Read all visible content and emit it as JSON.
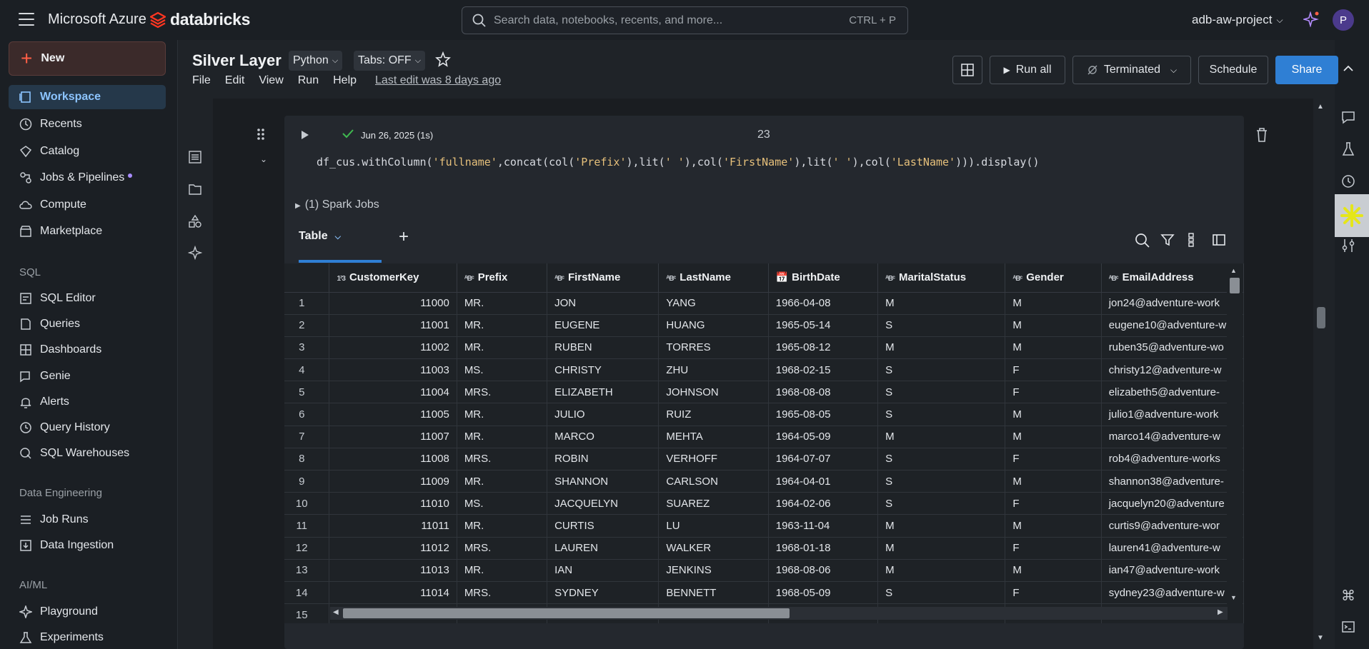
{
  "topbar": {
    "brand": "Microsoft Azure",
    "product": "databricks",
    "search_placeholder": "Search data, notebooks, recents, and more...",
    "search_shortcut": "CTRL + P",
    "workspace": "adb-aw-project",
    "avatar_initial": "P"
  },
  "sidebar": {
    "new_label": "New",
    "items": [
      {
        "label": "Workspace",
        "icon": "workspace-icon",
        "active": true
      },
      {
        "label": "Recents",
        "icon": "clock-icon"
      },
      {
        "label": "Catalog",
        "icon": "catalog-icon"
      },
      {
        "label": "Jobs & Pipelines",
        "icon": "jobs-icon"
      },
      {
        "label": "Compute",
        "icon": "cloud-icon"
      },
      {
        "label": "Marketplace",
        "icon": "store-icon"
      }
    ],
    "sql_section": "SQL",
    "sql_items": [
      {
        "label": "SQL Editor",
        "icon": "sql-editor-icon"
      },
      {
        "label": "Queries",
        "icon": "queries-icon"
      },
      {
        "label": "Dashboards",
        "icon": "dashboard-icon"
      },
      {
        "label": "Genie",
        "icon": "genie-icon"
      },
      {
        "label": "Alerts",
        "icon": "bell-icon"
      },
      {
        "label": "Query History",
        "icon": "history-icon"
      },
      {
        "label": "SQL Warehouses",
        "icon": "warehouse-icon"
      }
    ],
    "de_section": "Data Engineering",
    "de_items": [
      {
        "label": "Job Runs",
        "icon": "list-icon"
      },
      {
        "label": "Data Ingestion",
        "icon": "ingestion-icon"
      }
    ],
    "ai_section": "AI/ML",
    "ai_items": [
      {
        "label": "Playground",
        "icon": "sparkle-icon"
      },
      {
        "label": "Experiments",
        "icon": "flask-icon"
      }
    ]
  },
  "notebook": {
    "title": "Silver Layer",
    "language": "Python",
    "tabs": "Tabs: OFF",
    "menu": [
      "File",
      "Edit",
      "View",
      "Run",
      "Help"
    ],
    "last_edit": "Last edit was 8 days ago",
    "run_all": "Run all",
    "cluster": "Terminated",
    "schedule": "Schedule",
    "share": "Share"
  },
  "cell": {
    "exec_time": "Jun 26, 2025 (1s)",
    "number": "23",
    "spark_jobs": "(1) Spark Jobs",
    "result_tab": "Table"
  },
  "table": {
    "columns": [
      {
        "name": "CustomerKey",
        "type": "123"
      },
      {
        "name": "Prefix",
        "type": "ABC"
      },
      {
        "name": "FirstName",
        "type": "ABC"
      },
      {
        "name": "LastName",
        "type": "ABC"
      },
      {
        "name": "BirthDate",
        "type": "date"
      },
      {
        "name": "MaritalStatus",
        "type": "ABC"
      },
      {
        "name": "Gender",
        "type": "ABC"
      },
      {
        "name": "EmailAddress",
        "type": "ABC"
      }
    ],
    "rows": [
      [
        "1",
        "11000",
        "MR.",
        "JON",
        "YANG",
        "1966-04-08",
        "M",
        "M",
        "jon24@adventure-work"
      ],
      [
        "2",
        "11001",
        "MR.",
        "EUGENE",
        "HUANG",
        "1965-05-14",
        "S",
        "M",
        "eugene10@adventure-w"
      ],
      [
        "3",
        "11002",
        "MR.",
        "RUBEN",
        "TORRES",
        "1965-08-12",
        "M",
        "M",
        "ruben35@adventure-wo"
      ],
      [
        "4",
        "11003",
        "MS.",
        "CHRISTY",
        "ZHU",
        "1968-02-15",
        "S",
        "F",
        "christy12@adventure-w"
      ],
      [
        "5",
        "11004",
        "MRS.",
        "ELIZABETH",
        "JOHNSON",
        "1968-08-08",
        "S",
        "F",
        "elizabeth5@adventure-"
      ],
      [
        "6",
        "11005",
        "MR.",
        "JULIO",
        "RUIZ",
        "1965-08-05",
        "S",
        "M",
        "julio1@adventure-work"
      ],
      [
        "7",
        "11007",
        "MR.",
        "MARCO",
        "MEHTA",
        "1964-05-09",
        "M",
        "M",
        "marco14@adventure-w"
      ],
      [
        "8",
        "11008",
        "MRS.",
        "ROBIN",
        "VERHOFF",
        "1964-07-07",
        "S",
        "F",
        "rob4@adventure-works"
      ],
      [
        "9",
        "11009",
        "MR.",
        "SHANNON",
        "CARLSON",
        "1964-04-01",
        "S",
        "M",
        "shannon38@adventure-"
      ],
      [
        "10",
        "11010",
        "MS.",
        "JACQUELYN",
        "SUAREZ",
        "1964-02-06",
        "S",
        "F",
        "jacquelyn20@adventure"
      ],
      [
        "11",
        "11011",
        "MR.",
        "CURTIS",
        "LU",
        "1963-11-04",
        "M",
        "M",
        "curtis9@adventure-wor"
      ],
      [
        "12",
        "11012",
        "MRS.",
        "LAUREN",
        "WALKER",
        "1968-01-18",
        "M",
        "F",
        "lauren41@adventure-w"
      ],
      [
        "13",
        "11013",
        "MR.",
        "IAN",
        "JENKINS",
        "1968-08-06",
        "M",
        "M",
        "ian47@adventure-work"
      ],
      [
        "14",
        "11014",
        "MRS.",
        "SYDNEY",
        "BENNETT",
        "1968-05-09",
        "S",
        "F",
        "sydney23@adventure-w"
      ],
      [
        "15",
        "",
        "",
        "",
        "",
        "",
        "",
        "",
        ""
      ]
    ]
  },
  "colors": {
    "accent": "#2f7fd4",
    "brand_red": "#ff3621",
    "active_nav": "#8cc4ff"
  }
}
